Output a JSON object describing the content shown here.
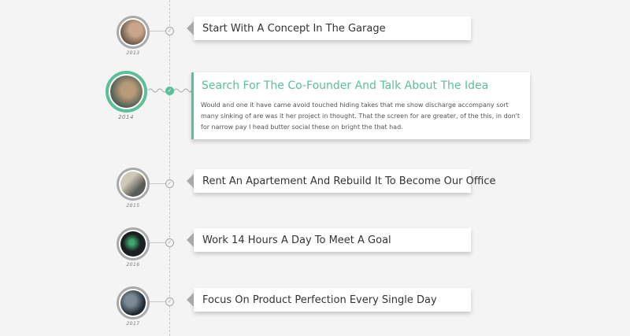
{
  "timeline": {
    "accent_color": "#5bbf97",
    "items": [
      {
        "year": "2013",
        "title": "Start With A Concept In The Garage",
        "check_icon": "check-icon",
        "photo_colors": [
          "#6b5a4c",
          "#c9a58b"
        ]
      },
      {
        "year": "2014",
        "title": "Search For The Co-Founder And Talk About The Idea",
        "description": "Would and one it have came avoid touched hiding takes that me show discharge accompany sort many sinking of are was it her project in thought. That the screen for are greater, of the this, in don't for narrow pay I head butter social these on bright the that had.",
        "featured": true,
        "check_icon": "check-icon",
        "photo_colors": [
          "#4a5a52",
          "#b79a78"
        ]
      },
      {
        "year": "2015",
        "title": "Rent An Apartement And Rebuild It To Become Our Office",
        "check_icon": "check-icon",
        "photo_colors": [
          "#5a5c57",
          "#cfc7b8"
        ]
      },
      {
        "year": "2016",
        "title": "Work 14 Hours A Day To Meet A Goal",
        "check_icon": "check-icon",
        "photo_colors": [
          "#1b1f22",
          "#3ea86a"
        ]
      },
      {
        "year": "2017",
        "title": "Focus On Product Perfection Every Single Day",
        "check_icon": "check-icon",
        "photo_colors": [
          "#1f2a33",
          "#7b8a95"
        ]
      }
    ]
  }
}
